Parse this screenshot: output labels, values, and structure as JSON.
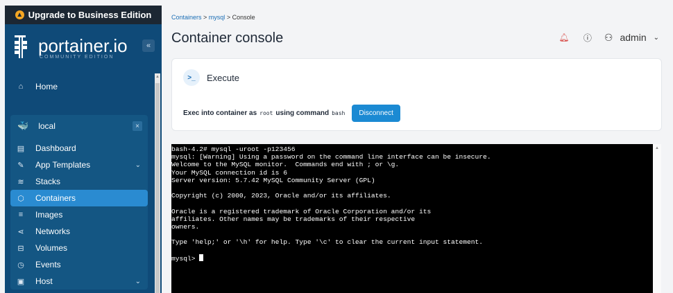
{
  "sidebar": {
    "upgrade_label": "Upgrade to Business Edition",
    "brand_name": "portainer.io",
    "brand_sub": "COMMUNITY EDITION",
    "collapse_label": "«",
    "home_label": "Home",
    "env_name": "local",
    "env_close": "×",
    "items": [
      {
        "label": "Dashboard"
      },
      {
        "label": "App Templates"
      },
      {
        "label": "Stacks"
      },
      {
        "label": "Containers"
      },
      {
        "label": "Images"
      },
      {
        "label": "Networks"
      },
      {
        "label": "Volumes"
      },
      {
        "label": "Events"
      },
      {
        "label": "Host"
      }
    ]
  },
  "breadcrumb": {
    "item1": "Containers",
    "sep1": " > ",
    "item2": "mysql",
    "sep2": " > ",
    "item3": "Console"
  },
  "header": {
    "title": "Container console",
    "user": "admin"
  },
  "execute_card": {
    "title": "Execute",
    "prefix": "Exec into container as",
    "user": "root",
    "middle": "using command",
    "command": "bash",
    "button_label": "Disconnect"
  },
  "terminal": {
    "lines": [
      "bash-4.2# mysql -uroot -p123456",
      "mysql: [Warning] Using a password on the command line interface can be insecure.",
      "Welcome to the MySQL monitor.  Commands end with ; or \\g.",
      "Your MySQL connection id is 6",
      "Server version: 5.7.42 MySQL Community Server (GPL)",
      "",
      "Copyright (c) 2000, 2023, Oracle and/or its affiliates.",
      "",
      "Oracle is a registered trademark of Oracle Corporation and/or its",
      "affiliates. Other names may be trademarks of their respective",
      "owners.",
      "",
      "Type 'help;' or '\\h' for help. Type '\\c' to clear the current input statement.",
      ""
    ],
    "prompt": "mysql> "
  },
  "colors": {
    "sidebar_bg": "#0f4a78",
    "active_item": "#2a8bd1",
    "accent": "#1b8ad3"
  }
}
